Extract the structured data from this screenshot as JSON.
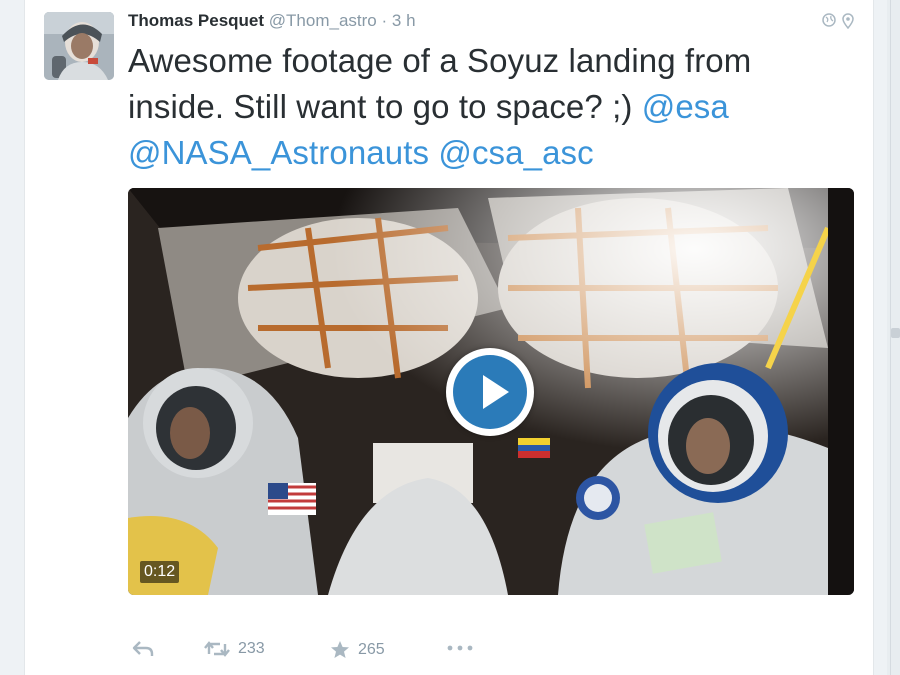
{
  "tweet": {
    "author_name": "Thomas Pesquet",
    "author_handle": "@Thom_astro",
    "separator": "·",
    "time": "3 h",
    "text_plain": "Awesome footage of a Soyuz landing from inside. Still want to go to space? ;)",
    "mentions": [
      "@esa",
      "@NASA_Astronauts",
      "@csa_asc"
    ]
  },
  "media": {
    "type": "video",
    "duration": "0:12",
    "play_icon": "play-icon"
  },
  "actions": {
    "reply_icon": "reply-icon",
    "retweet_icon": "retweet-icon",
    "retweet_count": "233",
    "favorite_icon": "star-icon",
    "favorite_count": "265",
    "more_icon": "more-icon"
  },
  "colors": {
    "link": "#3b94d9",
    "text": "#292f33",
    "muted": "#8899a6",
    "play": "#2b7bb9"
  }
}
